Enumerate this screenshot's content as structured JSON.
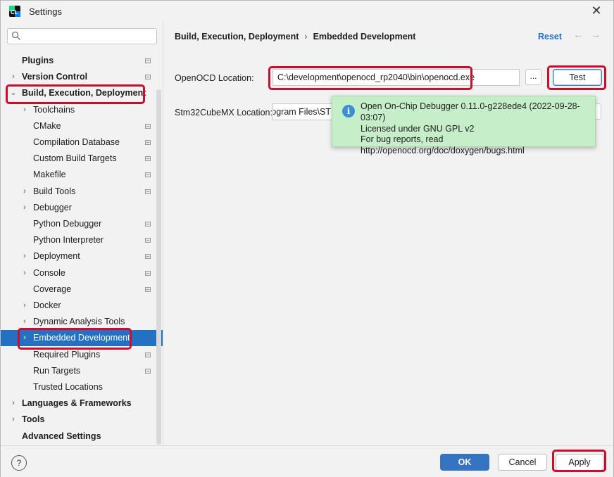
{
  "window": {
    "title": "Settings"
  },
  "search": {
    "placeholder": "",
    "value": ""
  },
  "sidebar": {
    "items": [
      {
        "label": "Plugins",
        "bold": true,
        "level": 0,
        "arrow": "",
        "mod": true
      },
      {
        "label": "Version Control",
        "bold": true,
        "level": 0,
        "arrow": "›",
        "mod": true
      },
      {
        "label": "Build, Execution, Deployment",
        "bold": true,
        "level": 0,
        "arrow": "⌄",
        "mod": false
      },
      {
        "label": "Toolchains",
        "bold": false,
        "level": 1,
        "arrow": "›",
        "mod": false
      },
      {
        "label": "CMake",
        "bold": false,
        "level": 1,
        "arrow": "",
        "mod": true
      },
      {
        "label": "Compilation Database",
        "bold": false,
        "level": 1,
        "arrow": "",
        "mod": true
      },
      {
        "label": "Custom Build Targets",
        "bold": false,
        "level": 1,
        "arrow": "",
        "mod": true
      },
      {
        "label": "Makefile",
        "bold": false,
        "level": 1,
        "arrow": "",
        "mod": true
      },
      {
        "label": "Build Tools",
        "bold": false,
        "level": 1,
        "arrow": "›",
        "mod": true
      },
      {
        "label": "Debugger",
        "bold": false,
        "level": 1,
        "arrow": "›",
        "mod": false
      },
      {
        "label": "Python Debugger",
        "bold": false,
        "level": 1,
        "arrow": "",
        "mod": true
      },
      {
        "label": "Python Interpreter",
        "bold": false,
        "level": 1,
        "arrow": "",
        "mod": true
      },
      {
        "label": "Deployment",
        "bold": false,
        "level": 1,
        "arrow": "›",
        "mod": true
      },
      {
        "label": "Console",
        "bold": false,
        "level": 1,
        "arrow": "›",
        "mod": true
      },
      {
        "label": "Coverage",
        "bold": false,
        "level": 1,
        "arrow": "",
        "mod": true
      },
      {
        "label": "Docker",
        "bold": false,
        "level": 1,
        "arrow": "›",
        "mod": false
      },
      {
        "label": "Dynamic Analysis Tools",
        "bold": false,
        "level": 1,
        "arrow": "›",
        "mod": false
      },
      {
        "label": "Embedded Development",
        "bold": false,
        "level": 1,
        "arrow": "›",
        "mod": false,
        "selected": true
      },
      {
        "label": "Required Plugins",
        "bold": false,
        "level": 1,
        "arrow": "",
        "mod": true
      },
      {
        "label": "Run Targets",
        "bold": false,
        "level": 1,
        "arrow": "",
        "mod": true
      },
      {
        "label": "Trusted Locations",
        "bold": false,
        "level": 1,
        "arrow": "",
        "mod": false
      },
      {
        "label": "Languages & Frameworks",
        "bold": true,
        "level": 0,
        "arrow": "›",
        "mod": false
      },
      {
        "label": "Tools",
        "bold": true,
        "level": 0,
        "arrow": "›",
        "mod": false
      },
      {
        "label": "Advanced Settings",
        "bold": true,
        "level": 0,
        "arrow": "",
        "mod": false
      }
    ]
  },
  "breadcrumb": {
    "parent": "Build, Execution, Deployment",
    "separator": "›",
    "current": "Embedded Development"
  },
  "header": {
    "reset": "Reset",
    "back_icon": "←",
    "forward_icon": "→"
  },
  "form": {
    "openocd_label": "OpenOCD Location:",
    "openocd_value": "C:\\development\\openocd_rp2040\\bin\\openocd.exe",
    "browse": "...",
    "test": "Test",
    "stm32_label": "Stm32CubeMX Location:",
    "stm32_value": "Program Files\\ST"
  },
  "tooltip": {
    "icon": "i",
    "lines": [
      "Open On-Chip Debugger 0.11.0-g228ede4 (2022-09-28-03:07)",
      "Licensed under GNU GPL v2",
      "For bug reports, read",
      "http://openocd.org/doc/doxygen/bugs.html"
    ]
  },
  "footer": {
    "help": "?",
    "ok": "OK",
    "cancel": "Cancel",
    "apply": "Apply"
  },
  "colors": {
    "accent": "#2470c2",
    "highlight": "#c8102e",
    "tooltip_bg": "#c6efc9"
  }
}
